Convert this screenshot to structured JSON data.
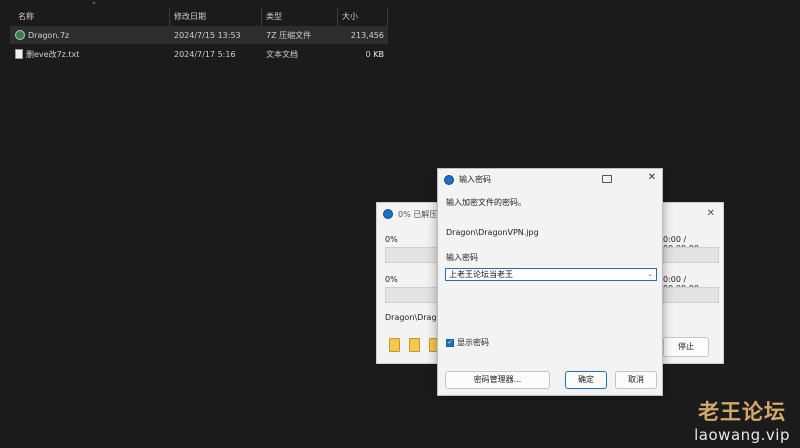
{
  "file_list": {
    "columns": [
      "名称",
      "修改日期",
      "类型",
      "大小"
    ],
    "rows": [
      {
        "name": "Dragon.7z",
        "date": "2024/7/15 13:53",
        "type": "7Z 压缩文件",
        "size": "213,456 KB",
        "icon": "7z-archive-icon",
        "selected": true
      },
      {
        "name": "删eve改7z.txt",
        "date": "2024/7/17 5:16",
        "type": "文本文档",
        "size": "0 KB",
        "icon": "text-file-icon",
        "selected": false
      }
    ]
  },
  "progress_window": {
    "title": "0% 已解压 D",
    "pct1": "0%",
    "pct2": "0%",
    "time1": "0:00 / 00:00:00",
    "time2": "0:00 / 00:00:00",
    "path": "Dragon\\Drago",
    "stop_label": "停止",
    "progress": 0
  },
  "password_dialog": {
    "title": "输入密码",
    "prompt": "输入加密文件的密码。",
    "file": "Dragon\\DragonVPN.jpg",
    "label": "输入密码",
    "value": "上老王论坛当老王",
    "show_password_label": "显示密码",
    "show_password_checked": true,
    "manager_label": "密码管理器...",
    "ok_label": "确定",
    "cancel_label": "取消"
  },
  "watermark": {
    "cn": "老王论坛",
    "url": "laowang.vip"
  },
  "colors": {
    "accent": "#1f6fc4",
    "background": "#1a1a1a",
    "dialog_bg": "#f3f3f3"
  }
}
